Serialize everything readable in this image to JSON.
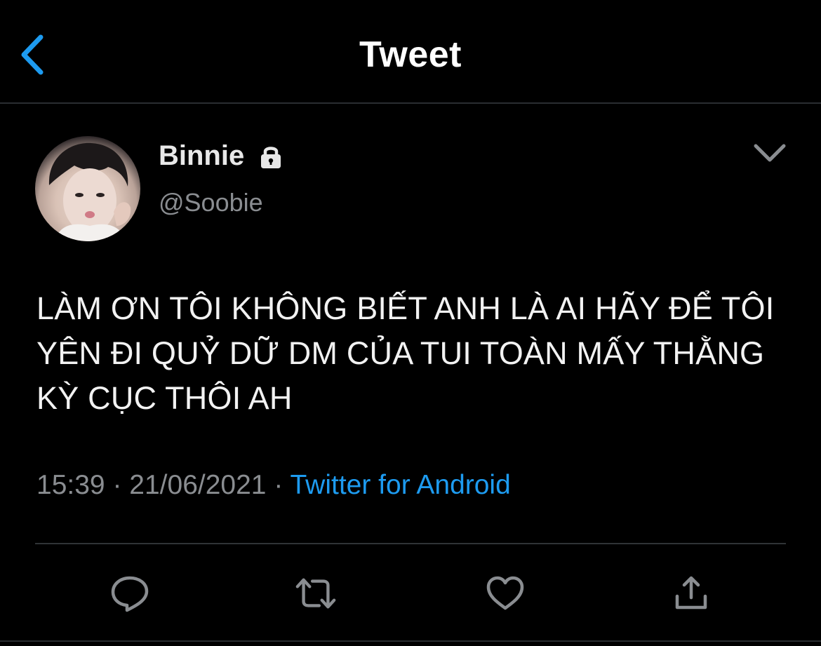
{
  "header": {
    "title": "Tweet",
    "back_icon": "chevron-left-icon"
  },
  "tweet": {
    "author_name": "Binnie",
    "author_handle": "@Soobie",
    "protected_icon": "lock-icon",
    "menu_icon": "chevron-down-icon",
    "text_lines": [
      "LÀM ƠN TÔI KHÔNG BIẾT ANH LÀ AI HÃY ĐỂ TÔI",
      "YÊN ĐI QUỶ DỮ DM CỦA TUI TOÀN MẤY THẰNG",
      "KỲ CỤC THÔI AH"
    ],
    "time": "15:39",
    "date": "21/06/2021",
    "separator": "·",
    "source": "Twitter for Android"
  },
  "actions": {
    "reply_icon": "reply-icon",
    "retweet_icon": "retweet-icon",
    "like_icon": "heart-icon",
    "share_icon": "share-icon"
  },
  "colors": {
    "background": "#000000",
    "accent": "#1d9bf0",
    "secondary_text": "#8a8d91"
  }
}
